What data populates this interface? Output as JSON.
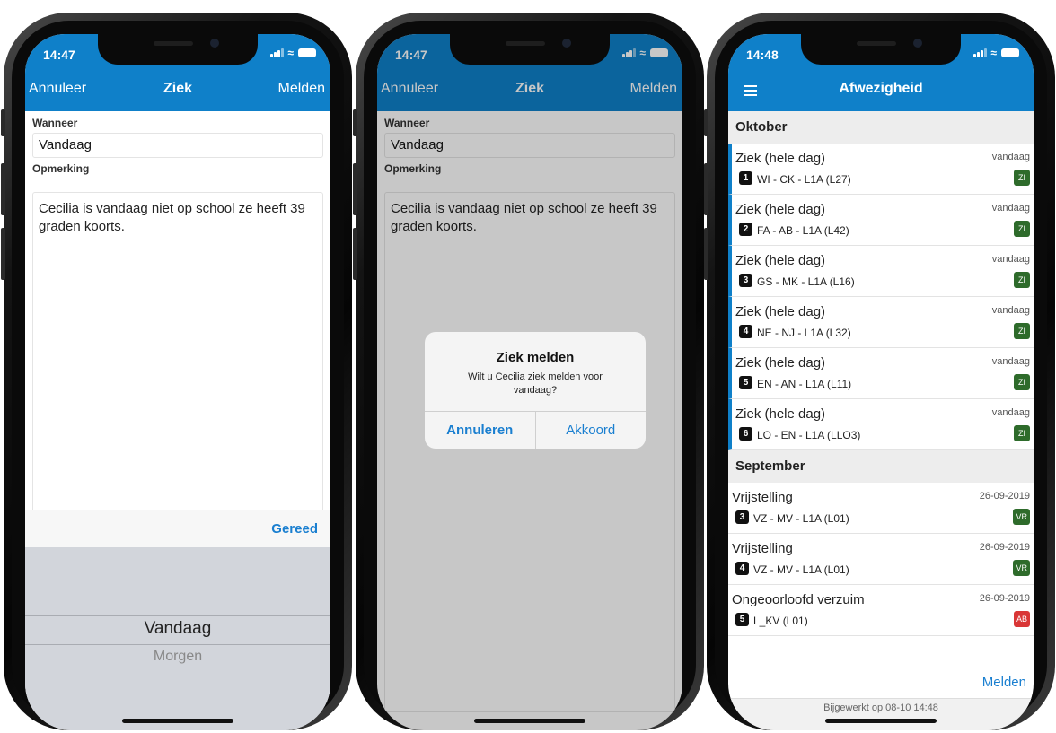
{
  "colors": {
    "nav_blue": "#0f80c9",
    "link_blue": "#1a7fd0",
    "badge_green": "#2e6b2b",
    "badge_red": "#d93636"
  },
  "phone1": {
    "status_time": "14:47",
    "nav": {
      "left": "Annuleer",
      "title": "Ziek",
      "right": "Melden"
    },
    "when_label": "Wanneer",
    "when_value": "Vandaag",
    "remark_label": "Opmerking",
    "remark_text": "Cecilia is vandaag niet op school ze heeft 39 graden koorts.",
    "done_label": "Gereed",
    "picker": {
      "selected": "Vandaag",
      "next": "Morgen"
    }
  },
  "phone2": {
    "status_time": "14:47",
    "nav": {
      "left": "Annuleer",
      "title": "Ziek",
      "right": "Melden"
    },
    "when_label": "Wanneer",
    "when_value": "Vandaag",
    "remark_label": "Opmerking",
    "remark_text": "Cecilia is vandaag niet op school ze heeft 39 graden koorts.",
    "alert": {
      "title": "Ziek melden",
      "message": "Wilt u Cecilia ziek melden voor vandaag?",
      "cancel": "Annuleren",
      "confirm": "Akkoord"
    }
  },
  "phone3": {
    "status_time": "14:48",
    "nav_title": "Afwezigheid",
    "sections": [
      {
        "title": "Oktober",
        "items": [
          {
            "title": "Ziek (hele dag)",
            "date": "vandaag",
            "num": "1",
            "sub": "WI - CK - L1A (L27)",
            "badge": "ZI",
            "badge_color": "#2e6b2b"
          },
          {
            "title": "Ziek (hele dag)",
            "date": "vandaag",
            "num": "2",
            "sub": "FA - AB - L1A (L42)",
            "badge": "ZI",
            "badge_color": "#2e6b2b"
          },
          {
            "title": "Ziek (hele dag)",
            "date": "vandaag",
            "num": "3",
            "sub": "GS - MK - L1A (L16)",
            "badge": "ZI",
            "badge_color": "#2e6b2b"
          },
          {
            "title": "Ziek (hele dag)",
            "date": "vandaag",
            "num": "4",
            "sub": "NE - NJ - L1A (L32)",
            "badge": "ZI",
            "badge_color": "#2e6b2b"
          },
          {
            "title": "Ziek (hele dag)",
            "date": "vandaag",
            "num": "5",
            "sub": "EN - AN - L1A (L11)",
            "badge": "ZI",
            "badge_color": "#2e6b2b"
          },
          {
            "title": "Ziek (hele dag)",
            "date": "vandaag",
            "num": "6",
            "sub": "LO - EN - L1A (LLO3)",
            "badge": "ZI",
            "badge_color": "#2e6b2b"
          }
        ]
      },
      {
        "title": "September",
        "items": [
          {
            "title": "Vrijstelling",
            "date": "26-09-2019",
            "num": "3",
            "sub": "VZ - MV - L1A (L01)",
            "badge": "VR",
            "badge_color": "#2e6b2b"
          },
          {
            "title": "Vrijstelling",
            "date": "26-09-2019",
            "num": "4",
            "sub": "VZ - MV - L1A (L01)",
            "badge": "VR",
            "badge_color": "#2e6b2b"
          },
          {
            "title": "Ongeoorloofd verzuim",
            "date": "26-09-2019",
            "num": "5",
            "sub": "L_KV (L01)",
            "badge": "AB",
            "badge_color": "#d93636"
          }
        ]
      }
    ],
    "report_link": "Melden",
    "updated": "Bijgewerkt op 08-10 14:48"
  }
}
